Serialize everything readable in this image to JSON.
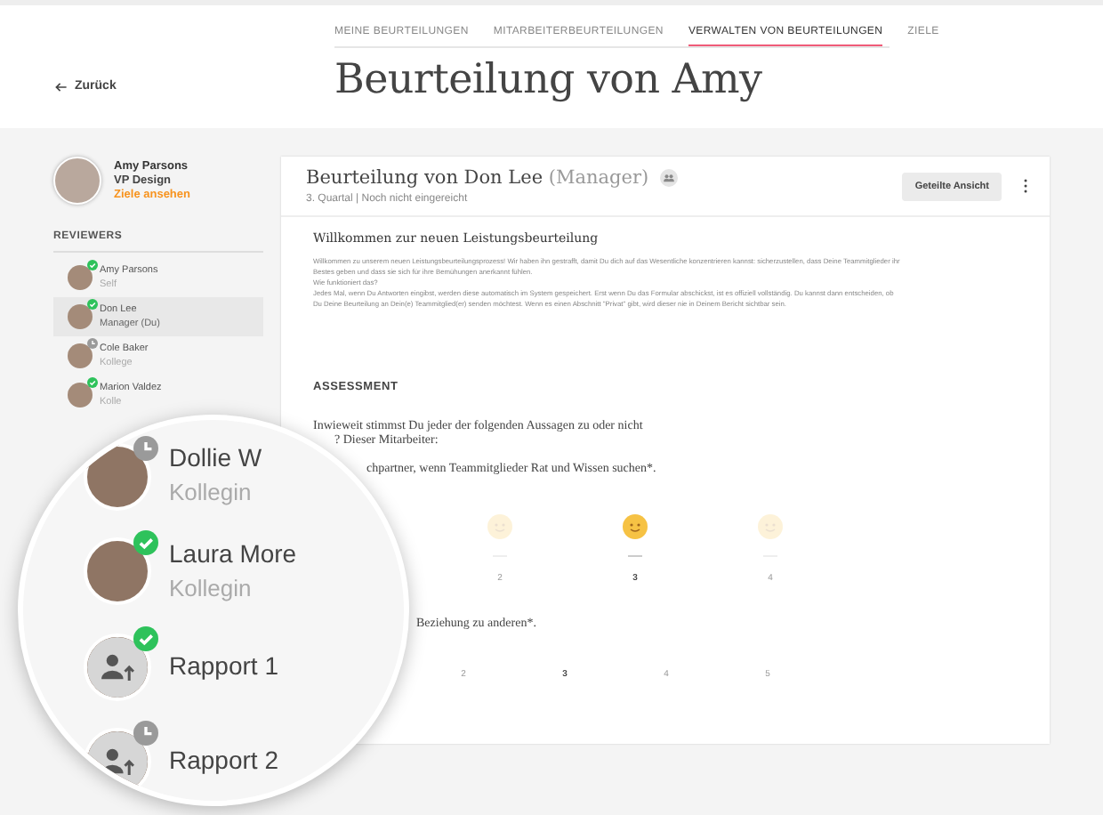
{
  "tabs": [
    {
      "label": "MEINE BEURTEILUNGEN",
      "selected": false
    },
    {
      "label": "MITARBEITERBEURTEILUNGEN",
      "selected": false
    },
    {
      "label": "VERWALTEN VON BEURTEILUNGEN",
      "selected": true
    },
    {
      "label": "ZIELE",
      "selected": false
    }
  ],
  "back_link": "Zurück",
  "page_title": "Beurteilung von Amy",
  "profile": {
    "name": "Amy Parsons",
    "role": "VP Design",
    "link": "Ziele ansehen"
  },
  "reviewers_heading": "REVIEWERS",
  "reviewers": [
    {
      "name": "Amy Parsons",
      "role": "Self",
      "done": true,
      "selected": false
    },
    {
      "name": "Don Lee",
      "role": "Manager (Du)",
      "done": true,
      "selected": true
    },
    {
      "name": "Cole Baker",
      "role": "Kollege",
      "done": false,
      "selected": false
    },
    {
      "name": "Marion Valdez",
      "role": "Kolle",
      "done": true,
      "selected": false
    }
  ],
  "card": {
    "title": "Beurteilung von Don Lee",
    "title_suffix": "(Manager)",
    "subtitle": "3. Quartal | Noch nicht eingereicht",
    "button": "Geteilte Ansicht"
  },
  "intro": {
    "heading": "Willkommen zur neuen Leistungsbeurteilung",
    "paragraphs": [
      "Willkommen zu unserem neuen Leistungsbeurteilungsprozess! Wir haben ihn gestrafft, damit Du dich auf das Wesentliche konzentrieren kannst: sicherzustellen, dass Deine Teammitglieder ihr Bestes geben und dass sie sich für ihre Bemühungen anerkannt fühlen.",
      "Wie funktioniert das?",
      "Jedes Mal, wenn Du Antworten eingibst, werden diese automatisch im System gespeichert. Erst wenn Du das Formular abschickst, ist es offiziell vollständig. Du kannst dann entscheiden, ob Du Deine Beurteilung an Dein(e) Teammitglied(er) senden möchtest. Wenn es einen Abschnitt \"Privat\" gibt, wird dieser nie in Deinem Bericht sichtbar sein."
    ]
  },
  "assessment": {
    "heading": "ASSESSMENT",
    "question_lines": [
      "Inwieweit stimmst Du jeder der folgenden Aussagen zu oder nicht",
      "? Dieser Mitarbeiter:"
    ],
    "statements": [
      {
        "text": "chpartner, wenn Teammitglieder Rat und Wissen suchen*.",
        "kind": "faces",
        "options": [
          {
            "label": "2",
            "selected": false
          },
          {
            "label": "3",
            "selected": true
          },
          {
            "label": "4",
            "selected": false
          }
        ]
      },
      {
        "text": "Beziehung zu anderen*.",
        "kind": "numbers",
        "options": [
          {
            "label": "2",
            "selected": false
          },
          {
            "label": "3",
            "selected": true
          },
          {
            "label": "4",
            "selected": false
          },
          {
            "label": "5",
            "selected": false
          }
        ]
      }
    ]
  },
  "magnifier": {
    "items": [
      {
        "name": "Dollie W",
        "role": "Kollegin",
        "done": false,
        "kind": "person"
      },
      {
        "name": "Laura More",
        "role": "Kollegin",
        "done": true,
        "kind": "person"
      },
      {
        "name": "Rapport 1",
        "done": true,
        "kind": "report"
      },
      {
        "name": "Rapport 2",
        "done": false,
        "kind": "report"
      }
    ]
  }
}
